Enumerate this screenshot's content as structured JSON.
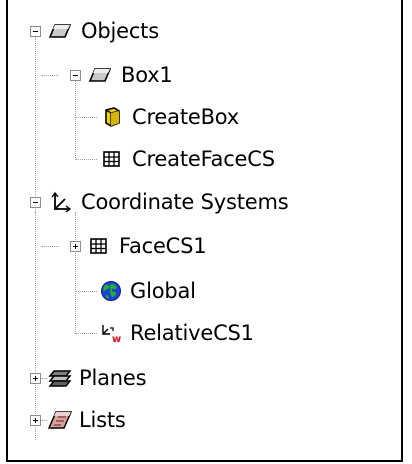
{
  "tree": {
    "items": [
      {
        "label": "Objects",
        "icon": "object-parallelogram-icon",
        "expanded": true
      },
      {
        "label": "Box1",
        "icon": "object-parallelogram-icon",
        "expanded": true
      },
      {
        "label": "CreateBox",
        "icon": "create-box-icon"
      },
      {
        "label": "CreateFaceCS",
        "icon": "face-cs-grid-icon"
      },
      {
        "label": "Coordinate Systems",
        "icon": "coordinate-axes-icon",
        "expanded": true
      },
      {
        "label": "FaceCS1",
        "icon": "face-cs-grid-icon",
        "expanded": false
      },
      {
        "label": "Global",
        "icon": "globe-icon"
      },
      {
        "label": "RelativeCS1",
        "icon": "relative-cs-icon"
      },
      {
        "label": "Planes",
        "icon": "planes-icon",
        "expanded": false
      },
      {
        "label": "Lists",
        "icon": "lists-icon",
        "expanded": false
      }
    ]
  }
}
